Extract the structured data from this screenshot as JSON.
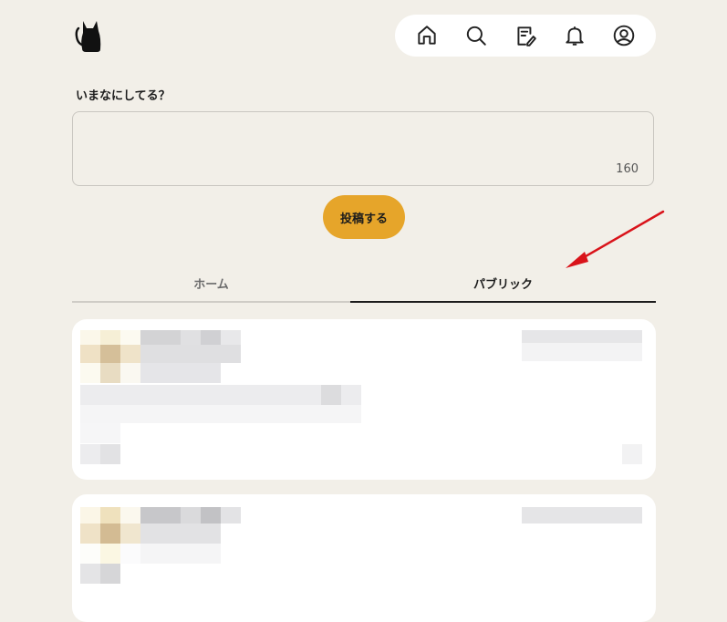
{
  "composer": {
    "prompt": "いまなにしてる？",
    "remaining_chars": "160",
    "submit_label": "投稿する"
  },
  "nav": {
    "icons": [
      "home-icon",
      "search-icon",
      "compose-icon",
      "bell-icon",
      "account-icon"
    ]
  },
  "tabs": [
    {
      "label": "ホーム",
      "active": false
    },
    {
      "label": "パブリック",
      "active": true
    }
  ],
  "colors": {
    "background": "#f2efe8",
    "accent": "#e6a52a",
    "annotation_arrow": "#d9131a"
  }
}
